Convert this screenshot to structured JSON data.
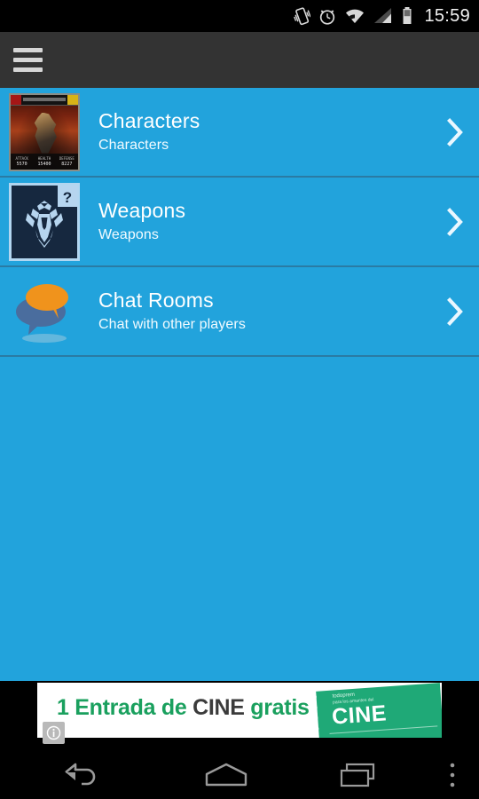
{
  "status_bar": {
    "time": "15:59",
    "icons": [
      "vibrate-icon",
      "alarm-icon",
      "wifi-icon",
      "signal-icon",
      "battery-icon"
    ]
  },
  "action_bar": {
    "menu_icon": "hamburger-menu-icon",
    "title": "",
    "background_color": "#333333"
  },
  "theme": {
    "list_background": "#22a3dc",
    "divider_color": "#2a7ba4",
    "title_color": "#ffffff",
    "subtitle_color": "#f2fbff"
  },
  "list": {
    "items": [
      {
        "title": "Characters",
        "subtitle": "Characters",
        "thumb": "transformers-card-thumbnail",
        "chevron": "chevron-right-icon",
        "card": {
          "stats": [
            {
              "label": "ATTACK",
              "value": "5570"
            },
            {
              "label": "HEALTH",
              "value": "15400"
            },
            {
              "label": "DEFENSE",
              "value": "8227"
            }
          ]
        }
      },
      {
        "title": "Weapons",
        "subtitle": "Weapons",
        "thumb": "autobot-logo-thumbnail",
        "badge": "?",
        "chevron": "chevron-right-icon"
      },
      {
        "title": "Chat Rooms",
        "subtitle": "Chat with other players",
        "thumb": "chat-bubbles-thumbnail",
        "chevron": "chevron-right-icon"
      }
    ]
  },
  "ad": {
    "headline_green": "1 Entrada de ",
    "headline_dark": "CINE",
    "headline_green2": " gratis",
    "ticket_label": "CINE",
    "ticket_tiny_top": "todoprem",
    "ticket_tiny_sub": "para los amantes del",
    "info_badge": "ad-info-icon"
  },
  "nav_bar": {
    "back": "back-icon",
    "home": "home-icon",
    "recents": "recents-icon",
    "overflow": "overflow-menu-icon"
  }
}
